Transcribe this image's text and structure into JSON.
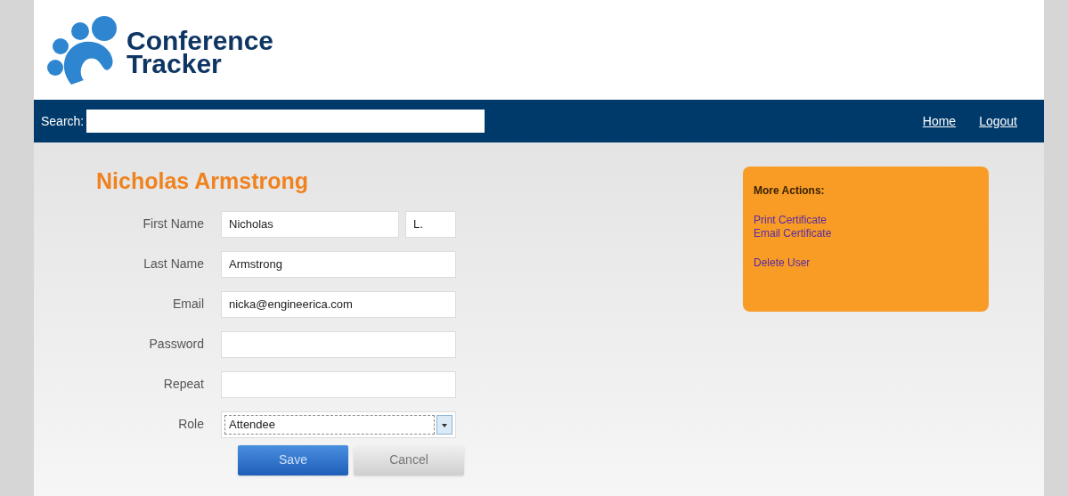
{
  "logo": {
    "line1": "Conference",
    "line2": "Tracker"
  },
  "nav": {
    "search_label": "Search:",
    "links": [
      "Home",
      "Logout"
    ]
  },
  "heading": "Nicholas Armstrong",
  "form": {
    "rows": [
      {
        "label": "First Name",
        "kind": "name",
        "value": "Nicholas",
        "middle": "L."
      },
      {
        "label": "Last Name",
        "kind": "text",
        "value": "Armstrong"
      },
      {
        "label": "Email",
        "kind": "text",
        "value": "nicka@engineerica.com"
      },
      {
        "label": "Password",
        "kind": "password"
      },
      {
        "label": "Repeat",
        "kind": "password"
      },
      {
        "label": "Role",
        "kind": "select",
        "value": "Attendee"
      }
    ],
    "buttons": [
      "Save",
      "Cancel"
    ]
  },
  "actions": {
    "title": "More Actions:",
    "groups": [
      [
        "Print Certificate",
        "Email Certificate"
      ],
      [
        "Delete User"
      ]
    ]
  }
}
